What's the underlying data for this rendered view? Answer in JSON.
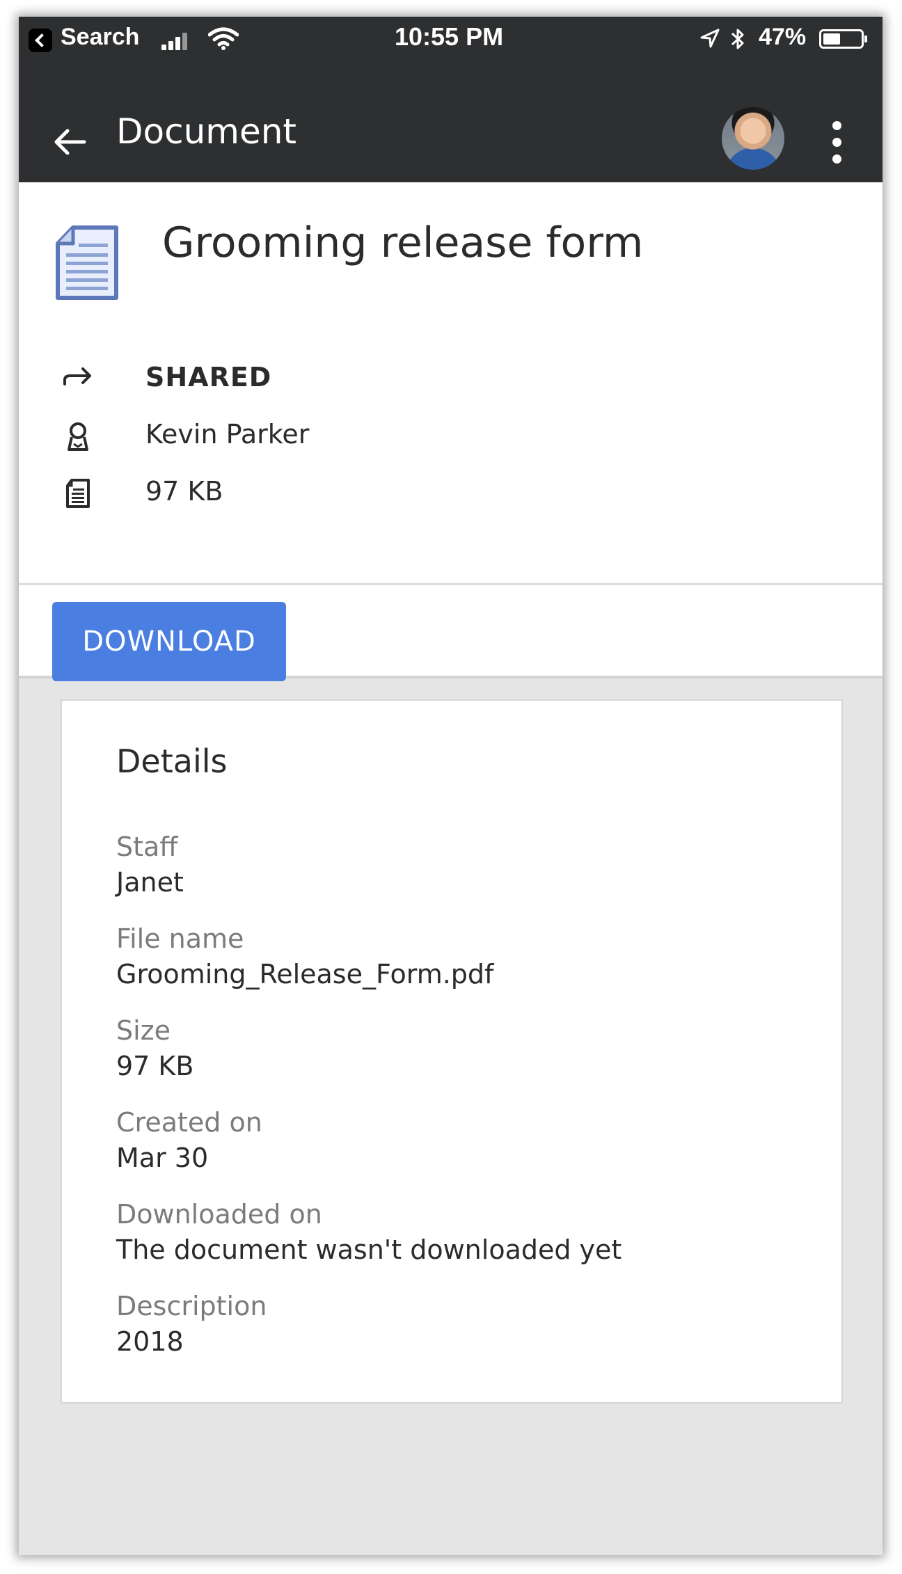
{
  "status_bar": {
    "carrier": "Search",
    "time": "10:55 PM",
    "battery_percent": "47%",
    "battery_level": 0.47
  },
  "app_bar": {
    "title": "Document"
  },
  "document": {
    "title": "Grooming release form",
    "status": "SHARED",
    "owner": "Kevin Parker",
    "size": "97 KB"
  },
  "actions": {
    "download_label": "DOWNLOAD"
  },
  "details": {
    "heading": "Details",
    "fields": [
      {
        "label": "Staff",
        "value": "Janet"
      },
      {
        "label": "File name",
        "value": "Grooming_Release_Form.pdf"
      },
      {
        "label": "Size",
        "value": "97 KB"
      },
      {
        "label": "Created on",
        "value": "Mar 30"
      },
      {
        "label": "Downloaded on",
        "value": "The document wasn't downloaded yet"
      },
      {
        "label": "Description",
        "value": "2018"
      }
    ]
  },
  "colors": {
    "app_bar_bg": "#2d2f31",
    "primary_button": "#4a7ee0",
    "doc_icon_blue": "#5d78b8"
  },
  "icons": [
    "back-arrow-icon",
    "more-vert-icon",
    "document-icon",
    "share-arrow-icon",
    "person-icon",
    "file-size-icon",
    "wifi-icon",
    "signal-icon",
    "battery-icon",
    "location-icon",
    "bluetooth-icon"
  ]
}
